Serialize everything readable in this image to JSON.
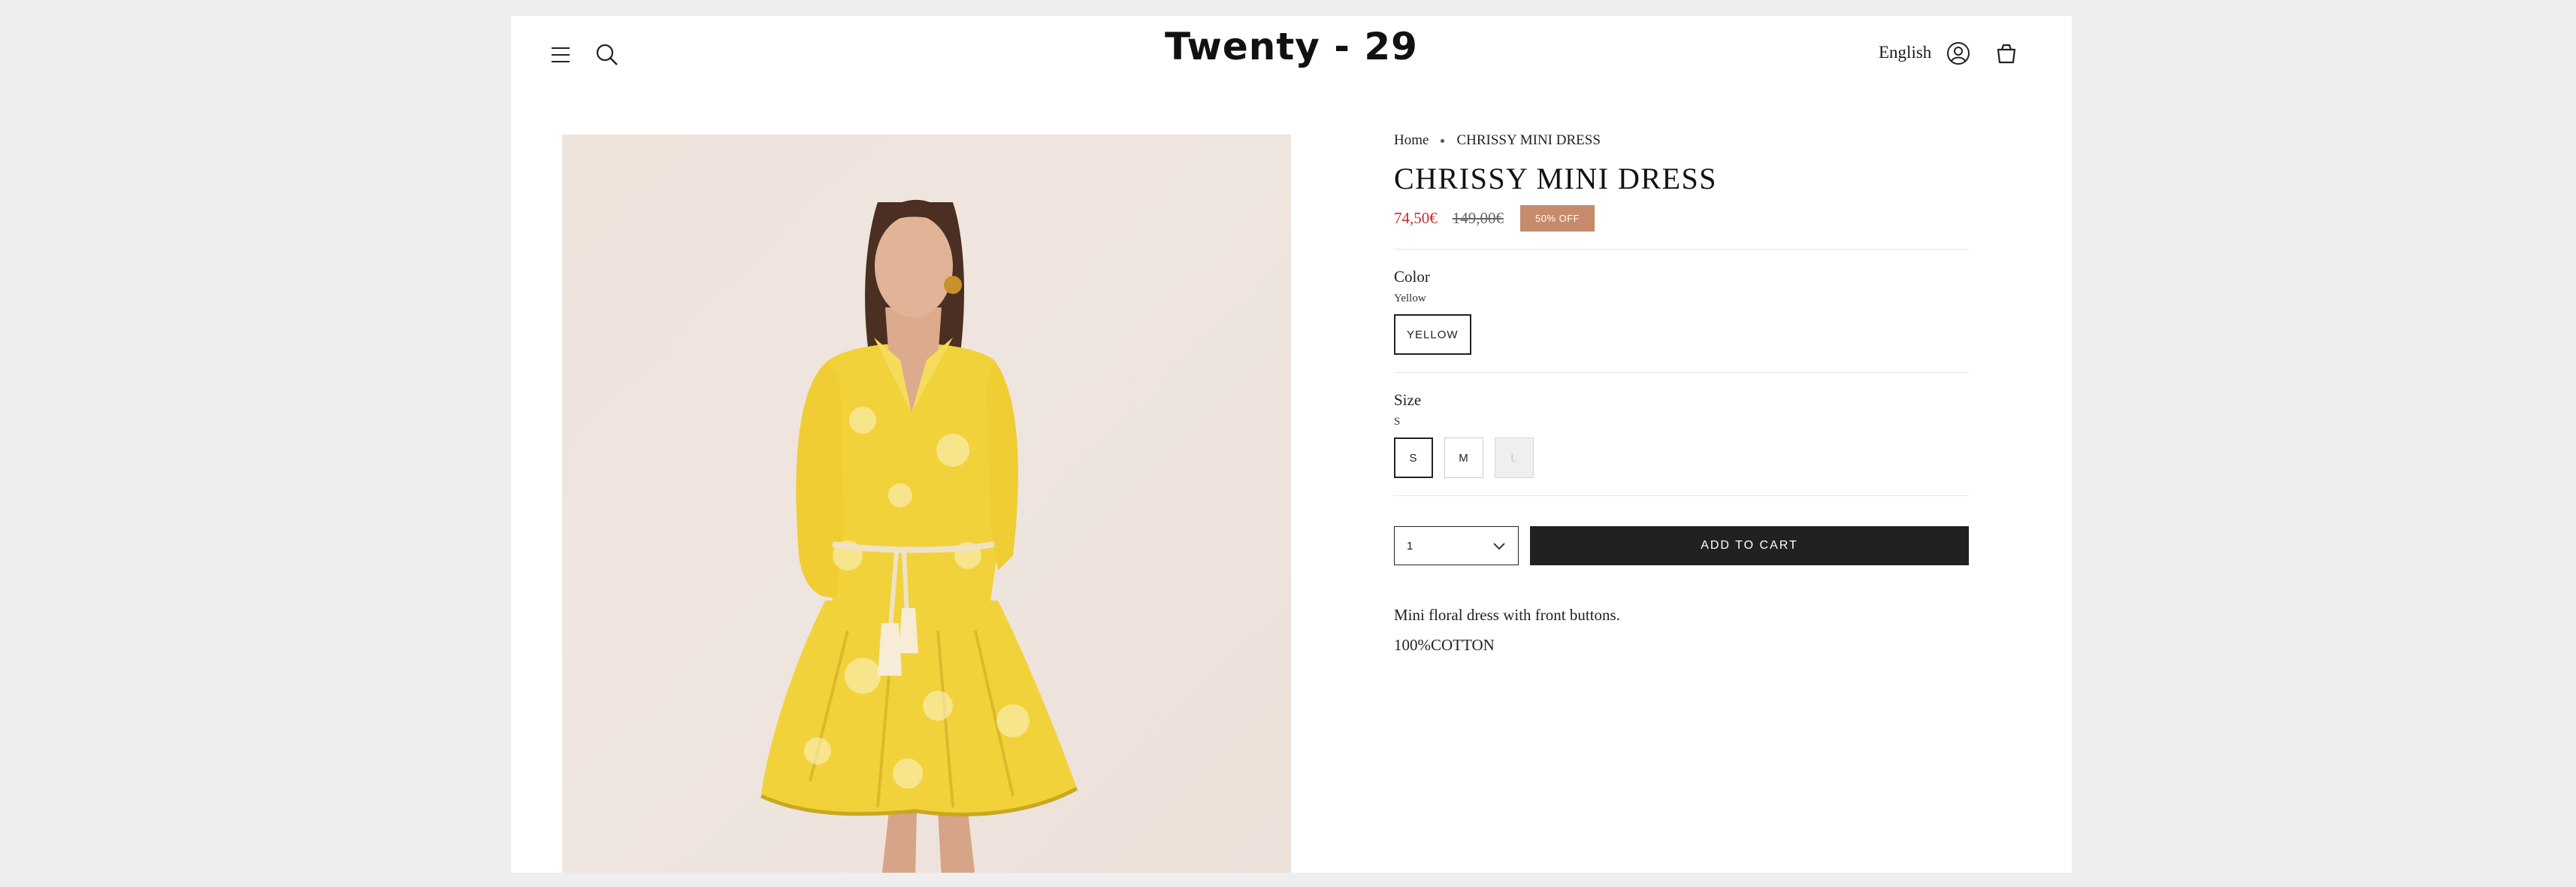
{
  "header": {
    "logo": "Twenty - 29",
    "language": "English",
    "icons": [
      "hamburger-menu-icon",
      "search-icon",
      "account-icon",
      "cart-icon"
    ]
  },
  "breadcrumb": {
    "home": "Home",
    "current": "CHRISSY MINI DRESS"
  },
  "product": {
    "title": "CHRISSY MINI DRESS",
    "price_sale": "74,50€",
    "price_original": "149,00€",
    "badge": "50% OFF",
    "color_label": "Color",
    "color_value": "Yellow",
    "color_options": [
      "YELLOW"
    ],
    "size_label": "Size",
    "size_value": "S",
    "size_options": [
      "S",
      "M",
      "L"
    ],
    "quantity": "1",
    "add_to_cart": "ADD TO CART",
    "description": "Mini floral dress with front buttons.",
    "material": "100%COTTON"
  },
  "colors": {
    "sale": "#c12f2f",
    "badge": "#c68a6c",
    "button": "#212121",
    "dress": "#f1d23a"
  }
}
